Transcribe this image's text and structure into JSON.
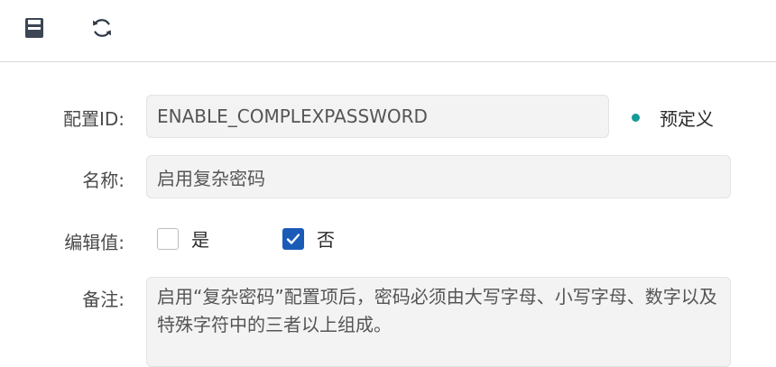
{
  "toolbar": {
    "save_icon": "save-icon",
    "refresh_icon": "refresh-icon"
  },
  "form": {
    "config_id": {
      "label": "配置ID:",
      "value": "ENABLE_COMPLEXPASSWORD"
    },
    "predefined": {
      "label": "预定义",
      "dot_color": "#159a97"
    },
    "name": {
      "label": "名称:",
      "value": "启用复杂密码"
    },
    "edit_value": {
      "label": "编辑值:",
      "options": [
        {
          "label": "是",
          "checked": false
        },
        {
          "label": "否",
          "checked": true
        }
      ],
      "checked_color": "#1a5bb8"
    },
    "remark": {
      "label": "备注:",
      "value": "启用“复杂密码”配置项后，密码必须由大写字母、小写字母、数字以及特殊字符中的三者以上组成。"
    }
  }
}
